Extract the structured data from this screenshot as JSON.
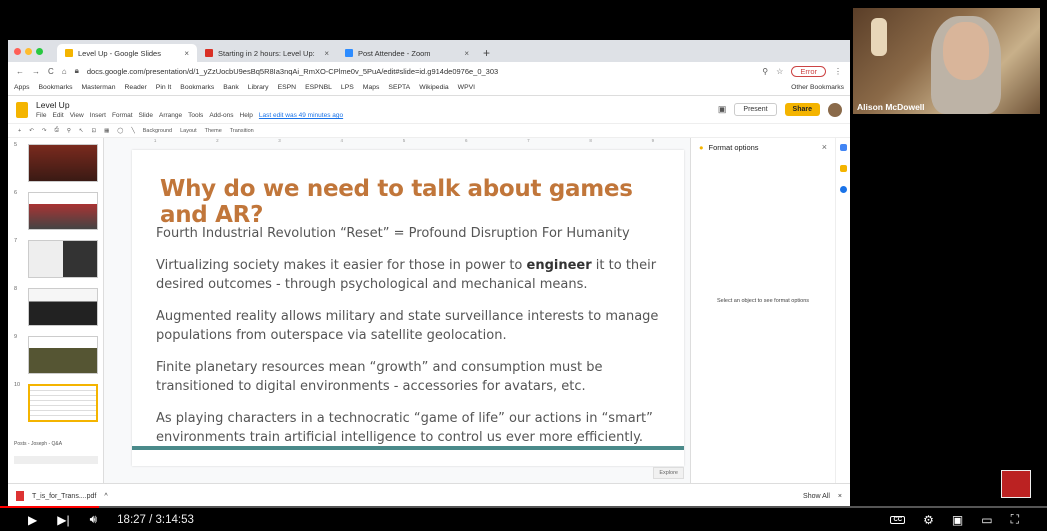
{
  "browser": {
    "tabs": [
      {
        "label": "Level Up - Google Slides",
        "color": "#f4b400",
        "active": true
      },
      {
        "label": "Starting in 2 hours: Level Up: ",
        "color": "#d93025",
        "active": false
      },
      {
        "label": "Post Attendee - Zoom",
        "color": "#2d8cff",
        "active": false
      }
    ],
    "url": "docs.google.com/presentation/d/1_yZzUocbU9esBq5R8Ia3nqAi_RmXO-CPlme0v_5PuA/edit#slide=id.g914de0976e_0_303",
    "error_label": "Error",
    "bookmarks": [
      "Apps",
      "Bookmarks",
      "Masterman",
      "Reader",
      "Pin It",
      "Bookmarks",
      "Bank",
      "Library",
      "ESPN",
      "ESPNBL",
      "LPS",
      "Maps",
      "SEPTA",
      "Wikipedia",
      "WPVI"
    ],
    "other_bookmarks": "Other Bookmarks"
  },
  "doc": {
    "title": "Level Up",
    "menus": [
      "File",
      "Edit",
      "View",
      "Insert",
      "Format",
      "Slide",
      "Arrange",
      "Tools",
      "Add-ons",
      "Help"
    ],
    "last_edit": "Last edit was 49 minutes ago",
    "present_label": "Present",
    "share_label": "Share",
    "toolbar_items": [
      "Background",
      "Layout",
      "Theme",
      "Transition"
    ]
  },
  "filmstrip": {
    "numbers": [
      "5",
      "6",
      "7",
      "8",
      "9",
      "10"
    ],
    "last_thumb_label": "Posts - Joseph - Q&A"
  },
  "slide": {
    "title": "Why do we need to talk about games and AR?",
    "bullets": [
      "Fourth Industrial Revolution “Reset” = Profound Disruption For Humanity",
      "Virtualizing society makes it easier for those in power to",
      "engineer",
      "it to their desired outcomes - through psychological and mechanical means.",
      "Augmented reality allows military and state surveillance interests to manage populations from outerspace via satellite geolocation.",
      "Finite planetary resources mean “growth” and consumption must be transitioned to digital environments - accessories for avatars, etc.",
      "As playing characters in a technocratic “game of life” our actions in “smart” environments train artificial intelligence to control us ever more efficiently."
    ],
    "explore_label": "Explore"
  },
  "format_panel": {
    "title": "Format options",
    "message": "Select an object to see format options"
  },
  "download": {
    "file": "T_is_for_Trans....pdf",
    "show_all": "Show All"
  },
  "webcam": {
    "name": "Alison McDowell"
  },
  "player": {
    "time": "18:27 / 3:14:53",
    "progress": 0.095,
    "accent": "#ff0000"
  }
}
